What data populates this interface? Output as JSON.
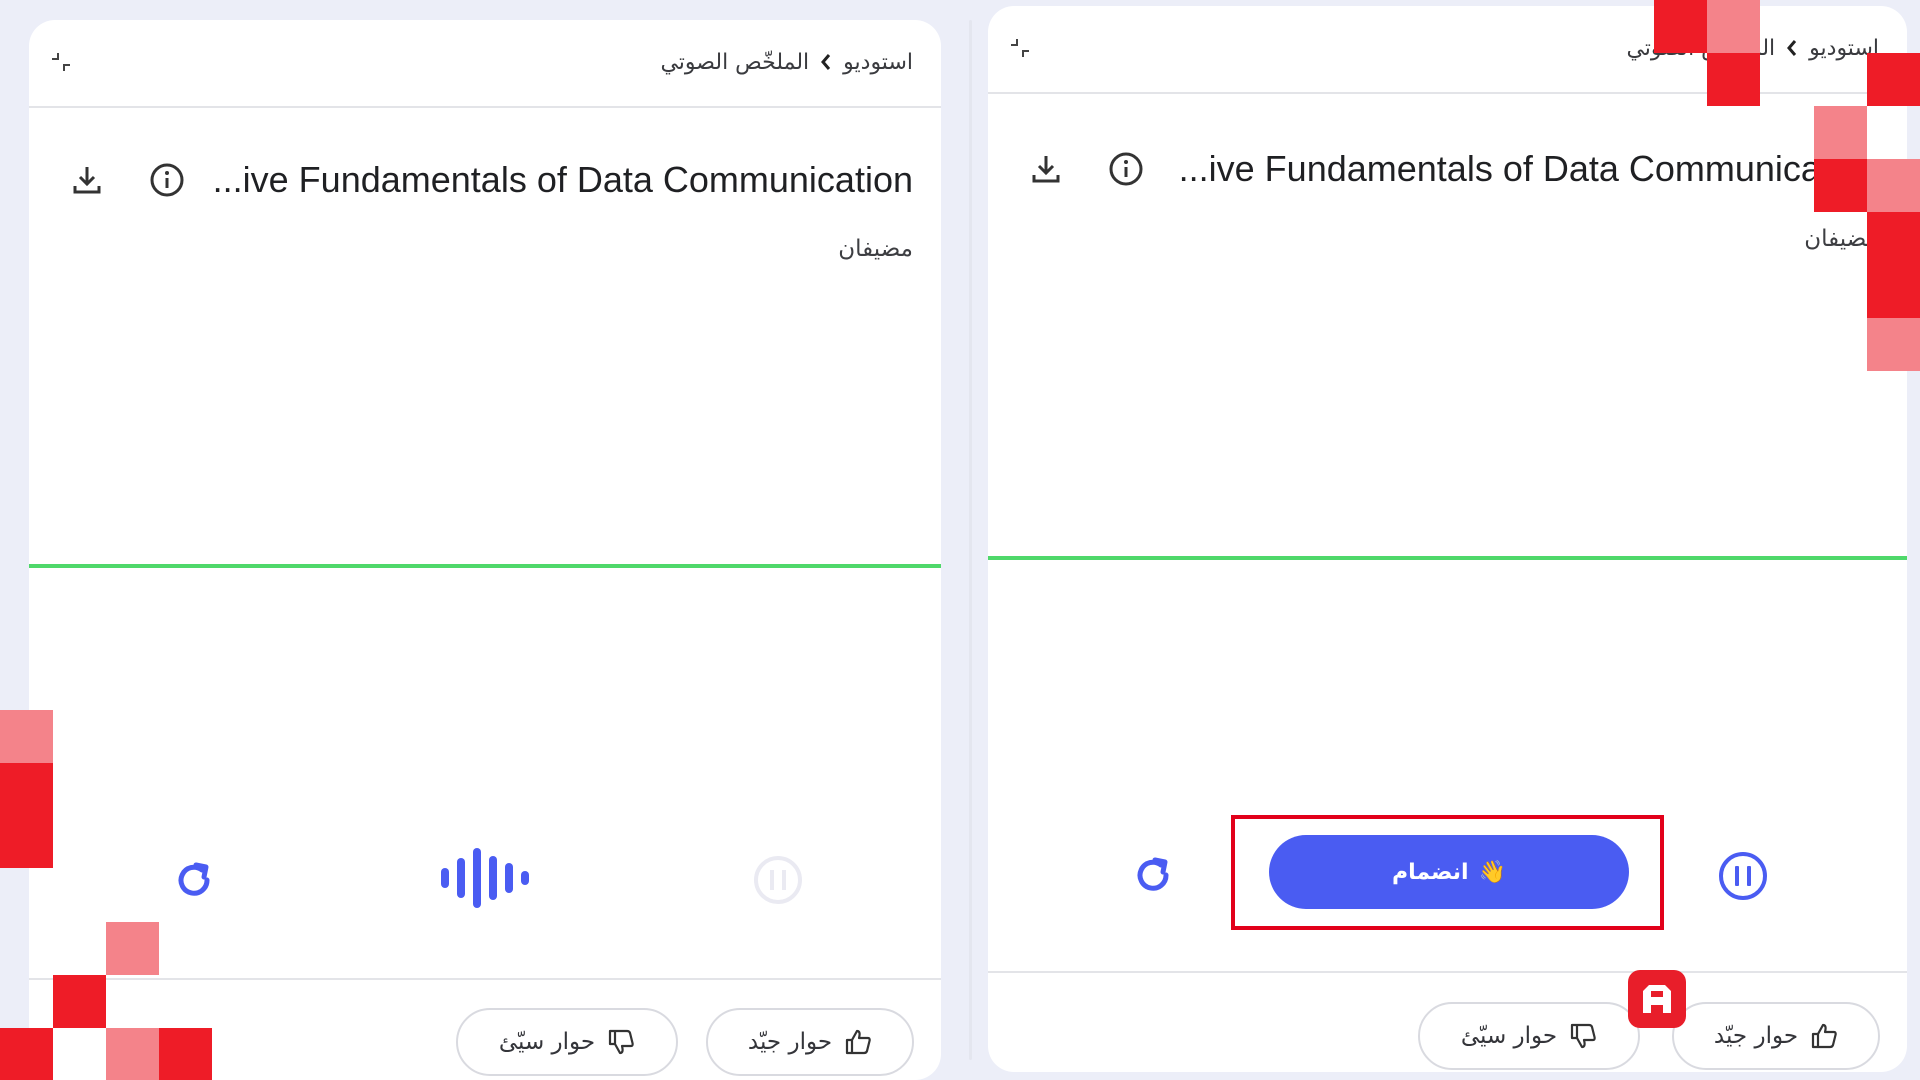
{
  "breadcrumb": {
    "root": "استوديو",
    "current": "الملخّص الصوتي"
  },
  "notebook": {
    "title": "...ive Fundamentals of Data Communication",
    "hosts_label": "مضيفان"
  },
  "controls": {
    "join_label": "انضمام",
    "join_emoji": "👋"
  },
  "feedback": {
    "good_label": "حوار جيّد",
    "bad_label": "حوار سيّئ"
  },
  "icons": {
    "collapse": "collapse-icon",
    "chevron": "chevron-left-icon",
    "download": "download-icon",
    "info": "info-icon",
    "replay": "replay-icon",
    "audio": "audio-wave-icon",
    "pause": "pause-icon",
    "thumbs_up": "thumbs-up-icon",
    "thumbs_down": "thumbs-down-icon"
  },
  "colors": {
    "accent": "#4a5cf2",
    "wave": "#4fd86a",
    "highlight": "#e2001a",
    "pixel_red": "#ee1c27",
    "pixel_pink": "#f4838a",
    "background": "#eceef8"
  }
}
